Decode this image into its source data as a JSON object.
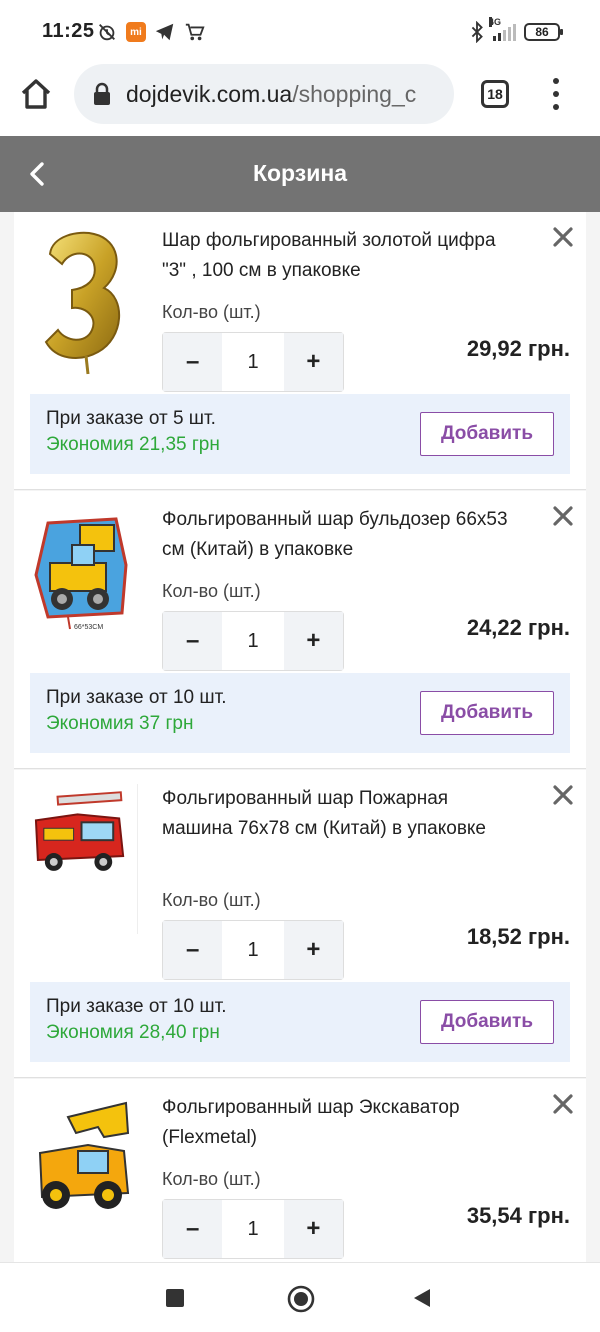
{
  "status_bar": {
    "time": "11:25",
    "battery": "86",
    "network": "4G"
  },
  "browser": {
    "url_domain": "dojdevik.com.ua",
    "url_path": "/shopping_c",
    "tab_count": "18"
  },
  "header": {
    "title": "Корзина"
  },
  "cart": {
    "qty_label": "Кол-во (шт.)",
    "items": [
      {
        "name": "Шар фольгированный золотой цифра \"3\" , 100 см в упаковке",
        "quantity": "1",
        "price": "29,92 грн.",
        "promo_line1": "При заказе от 5 шт.",
        "promo_line2": "Экономия 21,35 грн",
        "add_label": "Добавить",
        "image_icon": "gold-number-3-balloon-icon"
      },
      {
        "name": "Фольгированный шар бульдозер 66x53 см (Китай) в упаковке",
        "quantity": "1",
        "price": "24,22 грн.",
        "promo_line1": "При заказе от 10 шт.",
        "promo_line2": "Экономия 37 грн",
        "add_label": "Добавить",
        "image_icon": "bulldozer-balloon-icon",
        "image_caption": "66*53CM"
      },
      {
        "name": "Фольгированный шар Пожарная машина 76х78 см (Китай) в упаковке",
        "quantity": "1",
        "price": "18,52 грн.",
        "promo_line1": "При заказе от 10 шт.",
        "promo_line2": "Экономия 28,40 грн",
        "add_label": "Добавить",
        "image_icon": "fire-truck-balloon-icon"
      },
      {
        "name": "Фольгированный шар Экскаватор (Flexmetal)",
        "quantity": "1",
        "price": "35,54 грн.",
        "image_icon": "excavator-balloon-icon"
      }
    ]
  },
  "colors": {
    "header_bg": "#737373",
    "accent_purple": "#8a4da6",
    "savings_green": "#2ea83a",
    "promo_bg": "#eaf1fb"
  }
}
